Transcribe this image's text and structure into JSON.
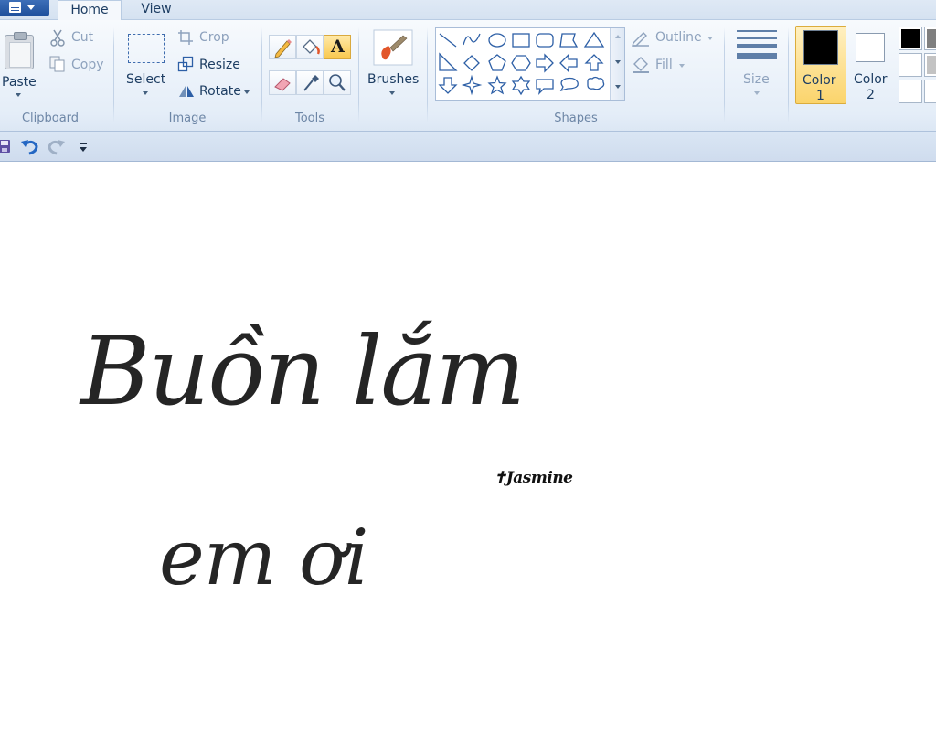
{
  "tabs": {
    "home": "Home",
    "view": "View"
  },
  "clipboard": {
    "paste": "Paste",
    "cut": "Cut",
    "copy": "Copy",
    "group": "Clipboard"
  },
  "image": {
    "select": "Select",
    "crop": "Crop",
    "resize": "Resize",
    "rotate": "Rotate",
    "group": "Image"
  },
  "tools": {
    "group": "Tools",
    "text_glyph": "A"
  },
  "brushes": {
    "label": "Brushes"
  },
  "shapes": {
    "group": "Shapes",
    "outline": "Outline",
    "fill": "Fill"
  },
  "size": {
    "label": "Size"
  },
  "colors": {
    "color1_label": "Color",
    "color1_num": "1",
    "color2_label": "Color",
    "color2_num": "2",
    "color1_value": "#000000",
    "color2_value": "#ffffff",
    "palette": [
      "#000000",
      "#7f7f7f",
      "#ffffff",
      "#c3c3c3",
      "#ffffff",
      "#ffffff"
    ]
  },
  "canvas": {
    "line1": "Buồn lắm",
    "line2": "em ơi",
    "signature": "✝Jasmine"
  },
  "icons": [
    "app-menu-icon",
    "paste-icon",
    "cut-icon",
    "copy-icon",
    "select-icon",
    "crop-icon",
    "resize-icon",
    "rotate-icon",
    "pencil-icon",
    "fill-icon",
    "text-icon",
    "eraser-icon",
    "color-picker-icon",
    "magnifier-icon",
    "brush-icon",
    "outline-icon",
    "fill-shape-icon",
    "size-icon",
    "save-icon",
    "undo-icon",
    "redo-icon",
    "customize-icon"
  ]
}
